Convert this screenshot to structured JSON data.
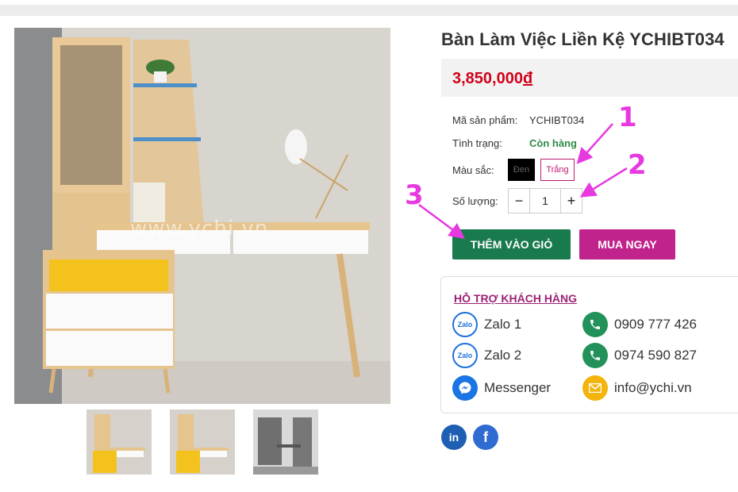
{
  "product": {
    "title": "Bàn Làm Việc Liền Kệ YCHIBT034",
    "price": "3,850,000",
    "currency": "đ",
    "sku_label": "Mã sản phẩm:",
    "sku_value": "YCHIBT034",
    "status_label": "Tình trạng:",
    "status_value": "Còn hàng",
    "color_label": "Màu sắc:",
    "colors": [
      "Đen",
      "Trắng"
    ],
    "qty_label": "Số lượng:",
    "qty_minus": "−",
    "qty_value": "1",
    "qty_plus": "+",
    "add_to_cart": "THÊM VÀO GIỎ",
    "buy_now": "MUA NGAY",
    "watermark": "www.ychi.vn"
  },
  "support": {
    "title": "HỖ TRỢ KHÁCH HÀNG",
    "items": [
      {
        "label": "Zalo 1",
        "icon": "zalo-icon",
        "icon_text": "Zalo"
      },
      {
        "label": "0909 777 426",
        "icon": "phone-icon"
      },
      {
        "label": "Zalo 2",
        "icon": "zalo-icon",
        "icon_text": "Zalo"
      },
      {
        "label": "0974 590 827",
        "icon": "phone-icon"
      },
      {
        "label": "Messenger",
        "icon": "messenger-icon"
      },
      {
        "label": "info@ychi.vn",
        "icon": "mail-icon"
      }
    ]
  },
  "social": [
    {
      "label": "in",
      "icon": "linkedin-icon",
      "color": "#1e5fb4"
    },
    {
      "label": "f",
      "icon": "facebook-icon",
      "color": "#2f6bd0"
    }
  ],
  "annotations": [
    "1",
    "2",
    "3"
  ],
  "colors": {
    "price": "#d0021b",
    "accent": "#c0238c",
    "cart": "#187a4d",
    "annotation": "#e838e0"
  }
}
